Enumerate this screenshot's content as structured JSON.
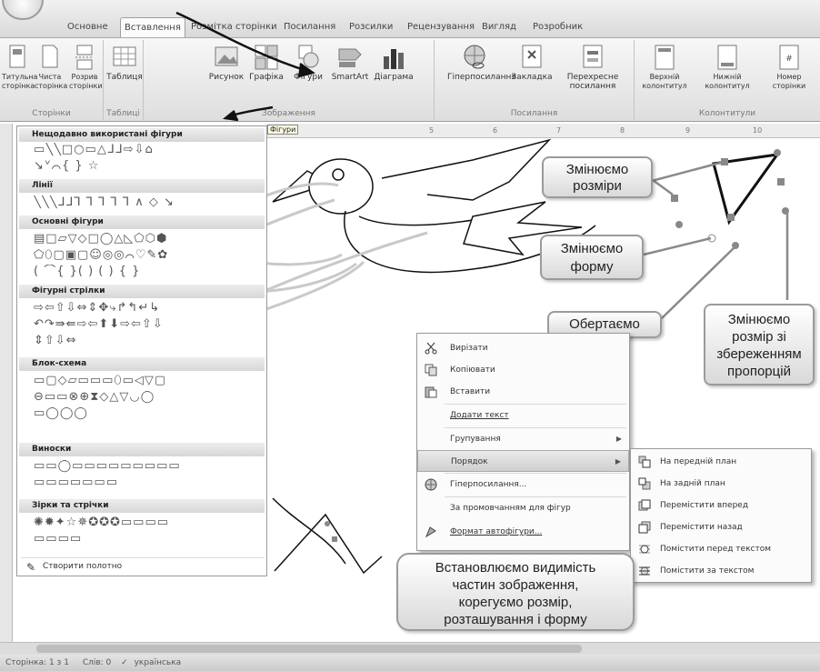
{
  "ribbon": {
    "tabs": [
      "Основне",
      "Вставлення",
      "Розмітка сторінки",
      "Посилання",
      "Розсилки",
      "Рецензування",
      "Вигляд",
      "Розробник"
    ],
    "active_tab": "Вставлення",
    "groups": {
      "pages": {
        "label": "Сторінки",
        "buttons": [
          "Титульна сторінка",
          "Чиста сторінка",
          "Розрив сторінки"
        ]
      },
      "tables": {
        "label": "Таблиці",
        "buttons": [
          "Таблиця"
        ]
      },
      "illustrations": {
        "label": "Зображення",
        "buttons": [
          "Рисунок",
          "Графіка",
          "Фігури",
          "SmartArt",
          "Діаграма"
        ]
      },
      "links": {
        "label": "Посилання",
        "buttons": [
          "Гіперпосилання",
          "Закладка",
          "Перехресне посилання"
        ]
      },
      "header_footer": {
        "label": "Колонтитули",
        "buttons": [
          "Верхній колонтитул",
          "Нижній колонтитул",
          "Номер сторінки"
        ]
      }
    }
  },
  "ruler": {
    "tooltip": "Фігури",
    "ticks": [
      "5",
      "6",
      "7",
      "8",
      "9",
      "10"
    ]
  },
  "shapes_panel": {
    "sections": [
      {
        "title": "Нещодавно використані фігури",
        "rows": [
          "▭╲╲□○▭△ᒧᒧ⇨⇩⌂",
          "↘ᘁ⌒{ } ☆"
        ]
      },
      {
        "title": "Лінії",
        "rows": [
          "╲╲╲ᒧᒧ⅂ ⅂ ⅂ ⅂ ⅂ ∧ ◇ ↘"
        ]
      },
      {
        "title": "Основні фігури",
        "rows": [
          "▤□▱▽◇□◯△◺⬠⬡⬢",
          "⬠⬯▢▣▢☺◎◎⌒♡✎✿",
          "( ⌒{ }( ) ( ) { }"
        ]
      },
      {
        "title": "Фігурні стрілки",
        "rows": [
          "⇨⇦⇧⇩⇔⇕✥⤷↱↰↵↳",
          "↶↷⇛⇚⇨⇦⬆⬇⇨⇦⇧⇩",
          "⇕⇧⇩⇔"
        ]
      },
      {
        "title": "Блок-схема",
        "rows": [
          "▭▢◇▱▭▭▭⬯▭◁▽▢",
          "⊖▭▭⊗⊕⧗◇△▽◡◯",
          "▭◯◯◯"
        ]
      },
      {
        "title": "Виноски",
        "rows": [
          "▭▭◯▭▭▭▭▭▭▭▭▭",
          "▭▭▭▭▭▭▭"
        ]
      },
      {
        "title": "Зірки та стрічки",
        "rows": [
          "✺✹✦☆✵✪✪✪▭▭▭▭",
          "▭▭▭▭"
        ]
      }
    ],
    "new_canvas": "Створити полотно"
  },
  "callouts": {
    "resize": "Змінюємо\nрозміри",
    "reshape": "Змінюємо\nформу",
    "rotate": "Обертаємо",
    "proportional": "Змінюємо\nрозмір зі\nзбереженням\nпропорцій",
    "visibility": "Встановлюємо видимість\nчастин зображення,\nкорегуємо розмір,\nрозташування і форму"
  },
  "context_menu": {
    "items": [
      {
        "label": "Вирізати",
        "icon": "scissors-icon"
      },
      {
        "label": "Копіювати",
        "icon": "copy-icon"
      },
      {
        "label": "Вставити",
        "icon": "paste-icon"
      },
      {
        "label": "Додати текст",
        "icon": ""
      },
      {
        "label": "Групування",
        "icon": "",
        "submenu": true
      },
      {
        "label": "Порядок",
        "icon": "",
        "submenu": true,
        "selected": true
      },
      {
        "label": "Гіперпосилання...",
        "icon": "hyperlink-icon"
      },
      {
        "label": "За промовчанням для фігур",
        "icon": ""
      },
      {
        "label": "Формат автофігури...",
        "icon": "format-icon"
      }
    ],
    "submenu": [
      "На передній план",
      "На задній план",
      "Перемістити вперед",
      "Перемістити назад",
      "Помістити перед текстом",
      "Помістити за текстом"
    ]
  },
  "statusbar": {
    "page": "Сторінка: 1 з 1",
    "words": "Слів: 0",
    "language": "українська"
  }
}
